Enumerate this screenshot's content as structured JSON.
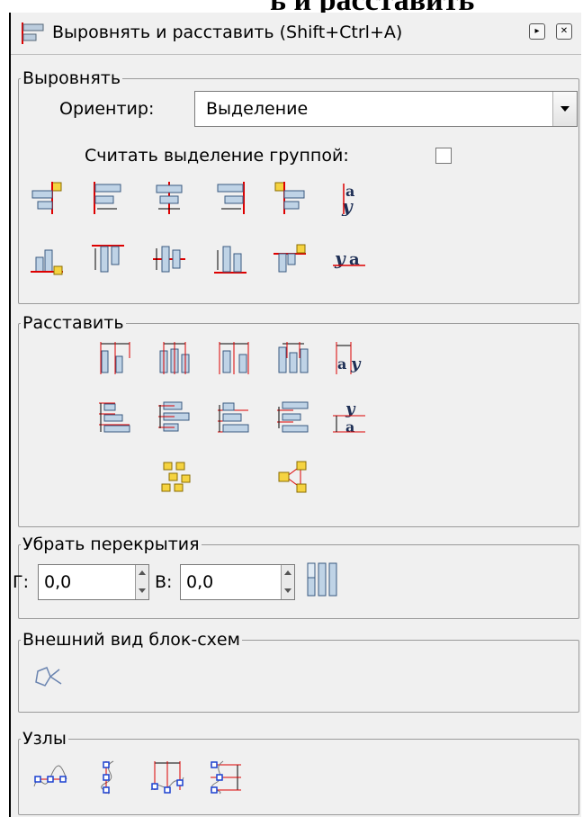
{
  "window": {
    "title": "Выровнять и расставить (Shift+Ctrl+A)"
  },
  "align": {
    "legend": "Выровнять",
    "relative_label": "Ориентир:",
    "relative_value": "Выделение",
    "treat_group_label": "Считать выделение группой:",
    "treat_group_checked": false
  },
  "distribute": {
    "legend": "Расставить"
  },
  "overlap": {
    "legend": "Убрать перекрытия",
    "h_label": "Г:",
    "h_value": "0,0",
    "v_label": "В:",
    "v_value": "0,0"
  },
  "connectors": {
    "legend": "Внешний вид блок-схем"
  },
  "nodes": {
    "legend": "Узлы"
  }
}
